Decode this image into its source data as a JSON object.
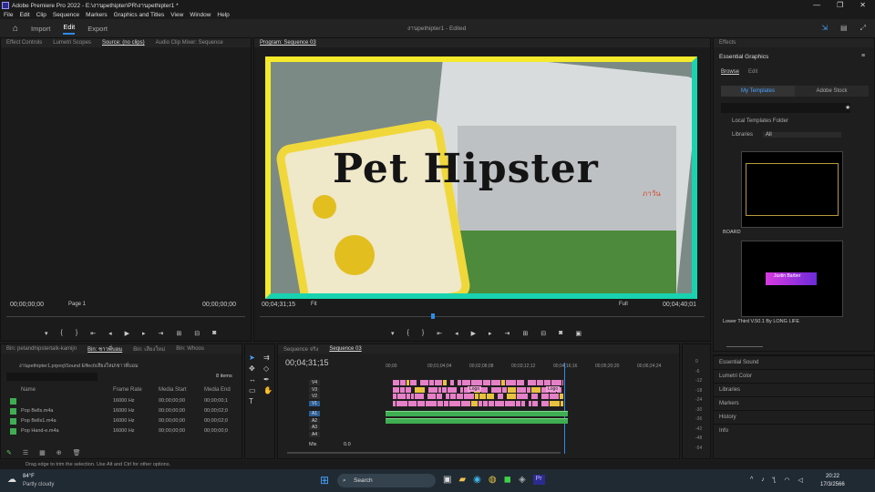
{
  "window": {
    "title": "Adobe Premiere Pro 2022 - E:\\งานpethipter\\PR\\งานpethipter1 *",
    "project": "งานpethipter1",
    "edited": "- Edited"
  },
  "menu": [
    "File",
    "Edit",
    "Clip",
    "Sequence",
    "Markers",
    "Graphics and Titles",
    "View",
    "Window",
    "Help"
  ],
  "workspaces": [
    "Import",
    "Edit",
    "Export"
  ],
  "source": {
    "tabs": [
      "Effect Controls",
      "Lumetri Scopes",
      "Source: (no clips)",
      "Audio Clip Mixer: Sequence"
    ],
    "tc_left": "00;00;00;00",
    "tc_right": "00;00;00;00",
    "page": "Page 1"
  },
  "program": {
    "tab": "Program: Sequence 03",
    "tc_left": "00;04;31;15",
    "tc_right": "00;04;40;01",
    "fit": "Fit",
    "full": "Full",
    "title_text": "Pet Hipster",
    "side_text": "ภาวัน"
  },
  "bin": {
    "tabs": [
      "Bin: petandhipstertalk-kamijn",
      "Bin: ชาวพี่บอม",
      "Bin: เสียงใหม่",
      "Bin: Whoos"
    ],
    "path": "งานpethipter1.prproj\\Sound Effect\\เสียงใหม่\\ชาวพี่บอม",
    "count": "8 items",
    "columns": [
      "Name",
      "Frame Rate",
      "Media Start",
      "Media End"
    ],
    "rows": [
      {
        "name": "",
        "rate": "16000 Hz",
        "start": "00;00;00;00",
        "end": "00;00;00;1"
      },
      {
        "name": "Pop Bells.m4a",
        "rate": "16000 Hz",
        "start": "00;00;00;00",
        "end": "00;00;02;0"
      },
      {
        "name": "Pop Bells1.m4a",
        "rate": "16000 Hz",
        "start": "00;00;00;00",
        "end": "00;00;02;0"
      },
      {
        "name": "Pop Hand-e.m4a",
        "rate": "16000 Hz",
        "start": "00;00;00;00",
        "end": "00;00;00;0"
      }
    ]
  },
  "timeline": {
    "tabs": [
      "Sequence จริง",
      "Sequence 03"
    ],
    "tc": "00;04;31;15",
    "ruler": [
      "00;00",
      "00;01;04;04",
      "00;02;08;08",
      "00;03;12;12",
      "00;04;16;16",
      "00;05;20;20",
      "00;06;24;24"
    ],
    "video_tracks": [
      "V4",
      "V3",
      "V2",
      "V1"
    ],
    "audio_tracks": [
      "A1",
      "A2",
      "A3",
      "A4"
    ],
    "mix": "Mix",
    "mix_val": "0.0",
    "labels": [
      "Logo",
      "Logo"
    ],
    "meter": [
      "0",
      "-6",
      "-12",
      "-18",
      "-24",
      "-30",
      "-36",
      "-42",
      "-48",
      "-54"
    ]
  },
  "eg": {
    "panel": "Effects",
    "title": "Essential Graphics",
    "tabs": [
      "Browse",
      "Edit"
    ],
    "sub": [
      "My Templates",
      "Adobe Stock"
    ],
    "chk1": "Local Templates Folder",
    "chk2": "Libraries",
    "lib": "All",
    "item1": "BOARD",
    "item2": "Lower Third V.50.1 By LONG LIFE",
    "card_name": "Justin Barber"
  },
  "right_list": [
    "Essential Sound",
    "Lumetri Color",
    "Libraries",
    "Markers",
    "History",
    "Info"
  ],
  "status": "Drag edge to trim the selection. Use Alt and Ctrl for other options.",
  "taskbar": {
    "weather_temp": "84°F",
    "weather_desc": "Partly cloudy",
    "search": "Search",
    "time": "20:22",
    "date": "17/3/2566"
  },
  "colors": {
    "accent": "#2d8ceb",
    "yellow_border": "#f4ea2a",
    "teal_border": "#19d3b0",
    "pink_clip": "#e680c8",
    "green_audio": "#3fae52"
  }
}
